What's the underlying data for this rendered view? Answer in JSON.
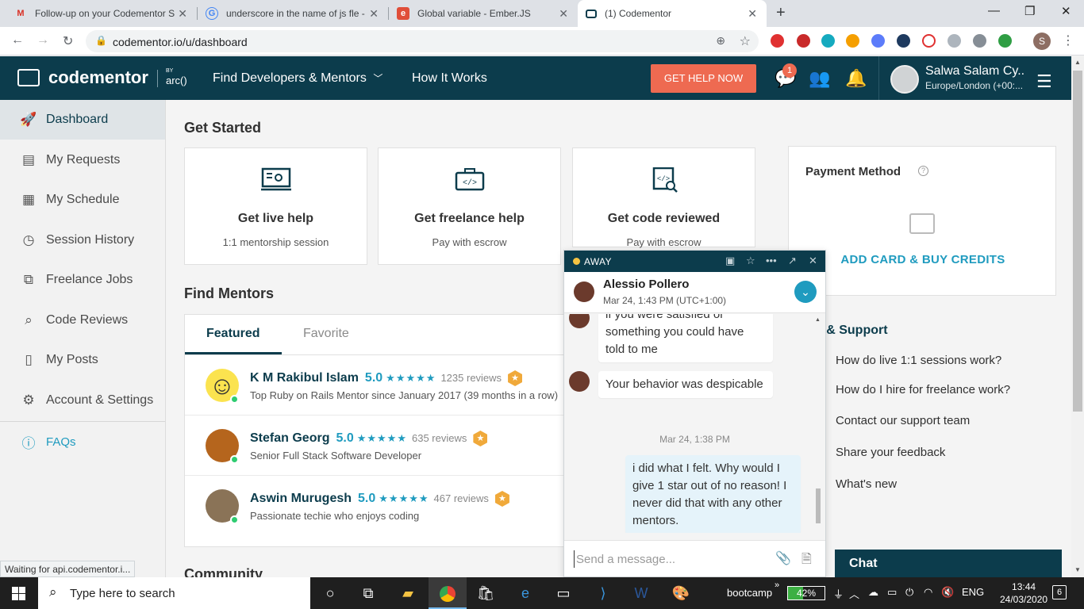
{
  "browser": {
    "tabs": [
      {
        "label": "Follow-up on your Codementor S",
        "favicon": "gmail-icon",
        "color": "#d93025"
      },
      {
        "label": "underscore in the name of js fle -",
        "favicon": "google-icon",
        "color": "#4285f4"
      },
      {
        "label": "Global variable - Ember.JS",
        "favicon": "ember-icon",
        "color": "#e04e39"
      },
      {
        "label": "(1) Codementor",
        "favicon": "codementor-icon",
        "color": "#0c3c4c"
      }
    ],
    "url": "codementor.io/u/dashboard"
  },
  "header": {
    "logo_text": "codementor",
    "logo_by": "BY",
    "logo_arc": "arc()",
    "nav": [
      "Find Developers & Mentors",
      "How It Works"
    ],
    "cta": "GET HELP NOW",
    "message_badge": "1",
    "user_name": "Salwa Salam Cy...",
    "user_tz": "Europe/London (+00:..."
  },
  "sidebar": {
    "items": [
      {
        "label": "Dashboard",
        "icon": "rocket-icon"
      },
      {
        "label": "My Requests",
        "icon": "requests-icon"
      },
      {
        "label": "My Schedule",
        "icon": "calendar-icon"
      },
      {
        "label": "Session History",
        "icon": "history-icon"
      },
      {
        "label": "Freelance Jobs",
        "icon": "freelance-icon"
      },
      {
        "label": "Code Reviews",
        "icon": "code-review-icon"
      },
      {
        "label": "My Posts",
        "icon": "posts-icon"
      },
      {
        "label": "Account & Settings",
        "icon": "gear-icon"
      }
    ],
    "faq": "FAQs"
  },
  "get_started": {
    "title": "Get Started",
    "cards": [
      {
        "title": "Get live help",
        "subtitle": "1:1 mentorship session"
      },
      {
        "title": "Get freelance help",
        "subtitle": "Pay with escrow"
      },
      {
        "title": "Get code reviewed",
        "subtitle": "Pay with escrow"
      }
    ]
  },
  "payment": {
    "title": "Payment Method",
    "action": "ADD CARD & BUY CREDITS"
  },
  "mentors": {
    "title": "Find Mentors",
    "tabs": [
      "Featured",
      "Favorite"
    ],
    "list": [
      {
        "name": "K M Rakibul Islam",
        "rating": "5.0",
        "reviews": "1235 reviews",
        "desc": "Top Ruby on Rails Mentor since January 2017 (39 months in a row)"
      },
      {
        "name": "Stefan Georg",
        "rating": "5.0",
        "reviews": "635 reviews",
        "desc": "Senior Full Stack Software Developer"
      },
      {
        "name": "Aswin Murugesh",
        "rating": "5.0",
        "reviews": "467 reviews",
        "desc": "Passionate techie who enjoys coding"
      }
    ],
    "stars": "★★★★★"
  },
  "community_title": "Community",
  "support": {
    "title": "p & Support",
    "links": [
      "How do live 1:1 sessions work?",
      "How do I hire for freelance work?",
      "Contact our support team",
      "Share your feedback",
      "What's new"
    ]
  },
  "chat": {
    "status": "AWAY",
    "contact_name": "Alessio Pollero",
    "contact_date": "Mar 24, 1:43 PM (UTC+1:00)",
    "messages": [
      {
        "text": "if you were satisfied or something you could have told to me"
      },
      {
        "text": "Your behavior was despicable"
      }
    ],
    "timestamp": "Mar 24, 1:38 PM",
    "my_message": "i did what I felt. Why would I give 1 star out of no reason! I never did that with any other mentors.",
    "input_placeholder": "Send a message...",
    "bar_label": "Chat"
  },
  "status_text": "Waiting for api.codementor.i...",
  "taskbar": {
    "search_placeholder": "Type here to search",
    "bootcamp_label": "bootcamp",
    "battery_percent": 42,
    "battery_label": "42%",
    "lang": "ENG",
    "time": "13:44",
    "date": "24/03/2020",
    "notifications": "6"
  }
}
